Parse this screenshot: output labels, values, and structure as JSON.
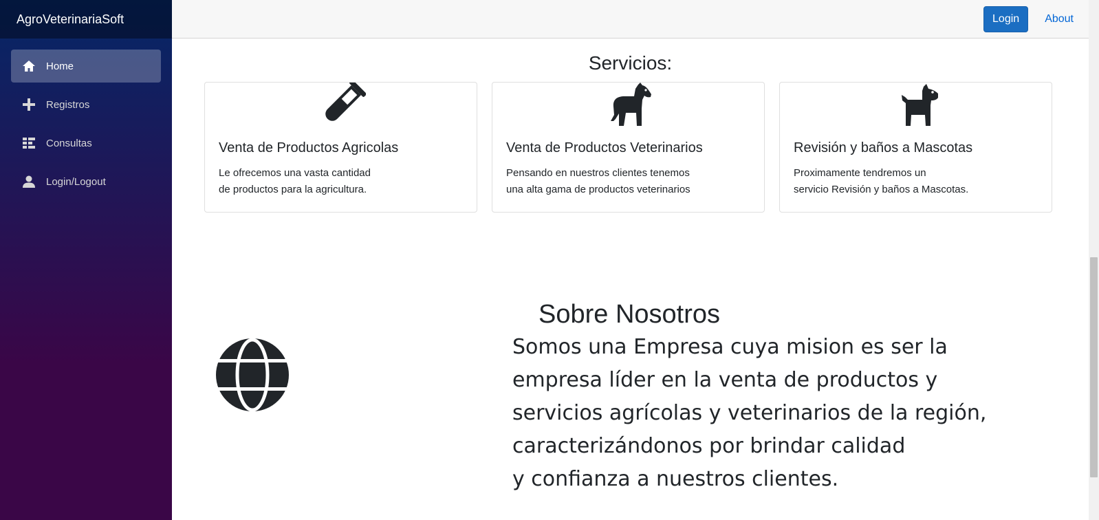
{
  "sidebar": {
    "brand": "AgroVeterinariaSoft",
    "items": [
      {
        "label": "Home",
        "icon": "home-icon",
        "active": true
      },
      {
        "label": "Registros",
        "icon": "plus-icon"
      },
      {
        "label": "Consultas",
        "icon": "list-icon"
      },
      {
        "label": "Login/Logout",
        "icon": "person-icon"
      }
    ]
  },
  "header": {
    "login_label": "Login",
    "about_label": "About"
  },
  "services": {
    "title": "Servicios:",
    "cards": [
      {
        "icon": "test-tube-icon",
        "title": "Venta de Productos Agricolas",
        "line1": "Le ofrecemos una vasta cantidad",
        "line2": "de productos para la agricultura."
      },
      {
        "icon": "horse-icon",
        "title": "Venta de Productos Veterinarios",
        "line1": "Pensando en nuestros clientes tenemos",
        "line2": "una alta gama de productos veterinarios"
      },
      {
        "icon": "dog-icon",
        "title": "Revisión y baños a Mascotas",
        "line1": "Proximamente tendremos un",
        "line2": "servicio Revisión y baños a Mascotas."
      }
    ]
  },
  "about": {
    "icon": "globe-icon",
    "title": "Sobre Nosotros",
    "lines": [
      "Somos una Empresa cuya mision es ser la",
      "empresa líder en la venta de productos y",
      "servicios agrícolas y veterinarios de la región,",
      "caracterizándonos por brindar calidad",
      "y confianza a nuestros clientes."
    ]
  },
  "colors": {
    "sidebar_top": "#052767",
    "sidebar_bottom": "#3a0647",
    "primary_button": "#1b6ec2",
    "link": "#0366d6"
  }
}
